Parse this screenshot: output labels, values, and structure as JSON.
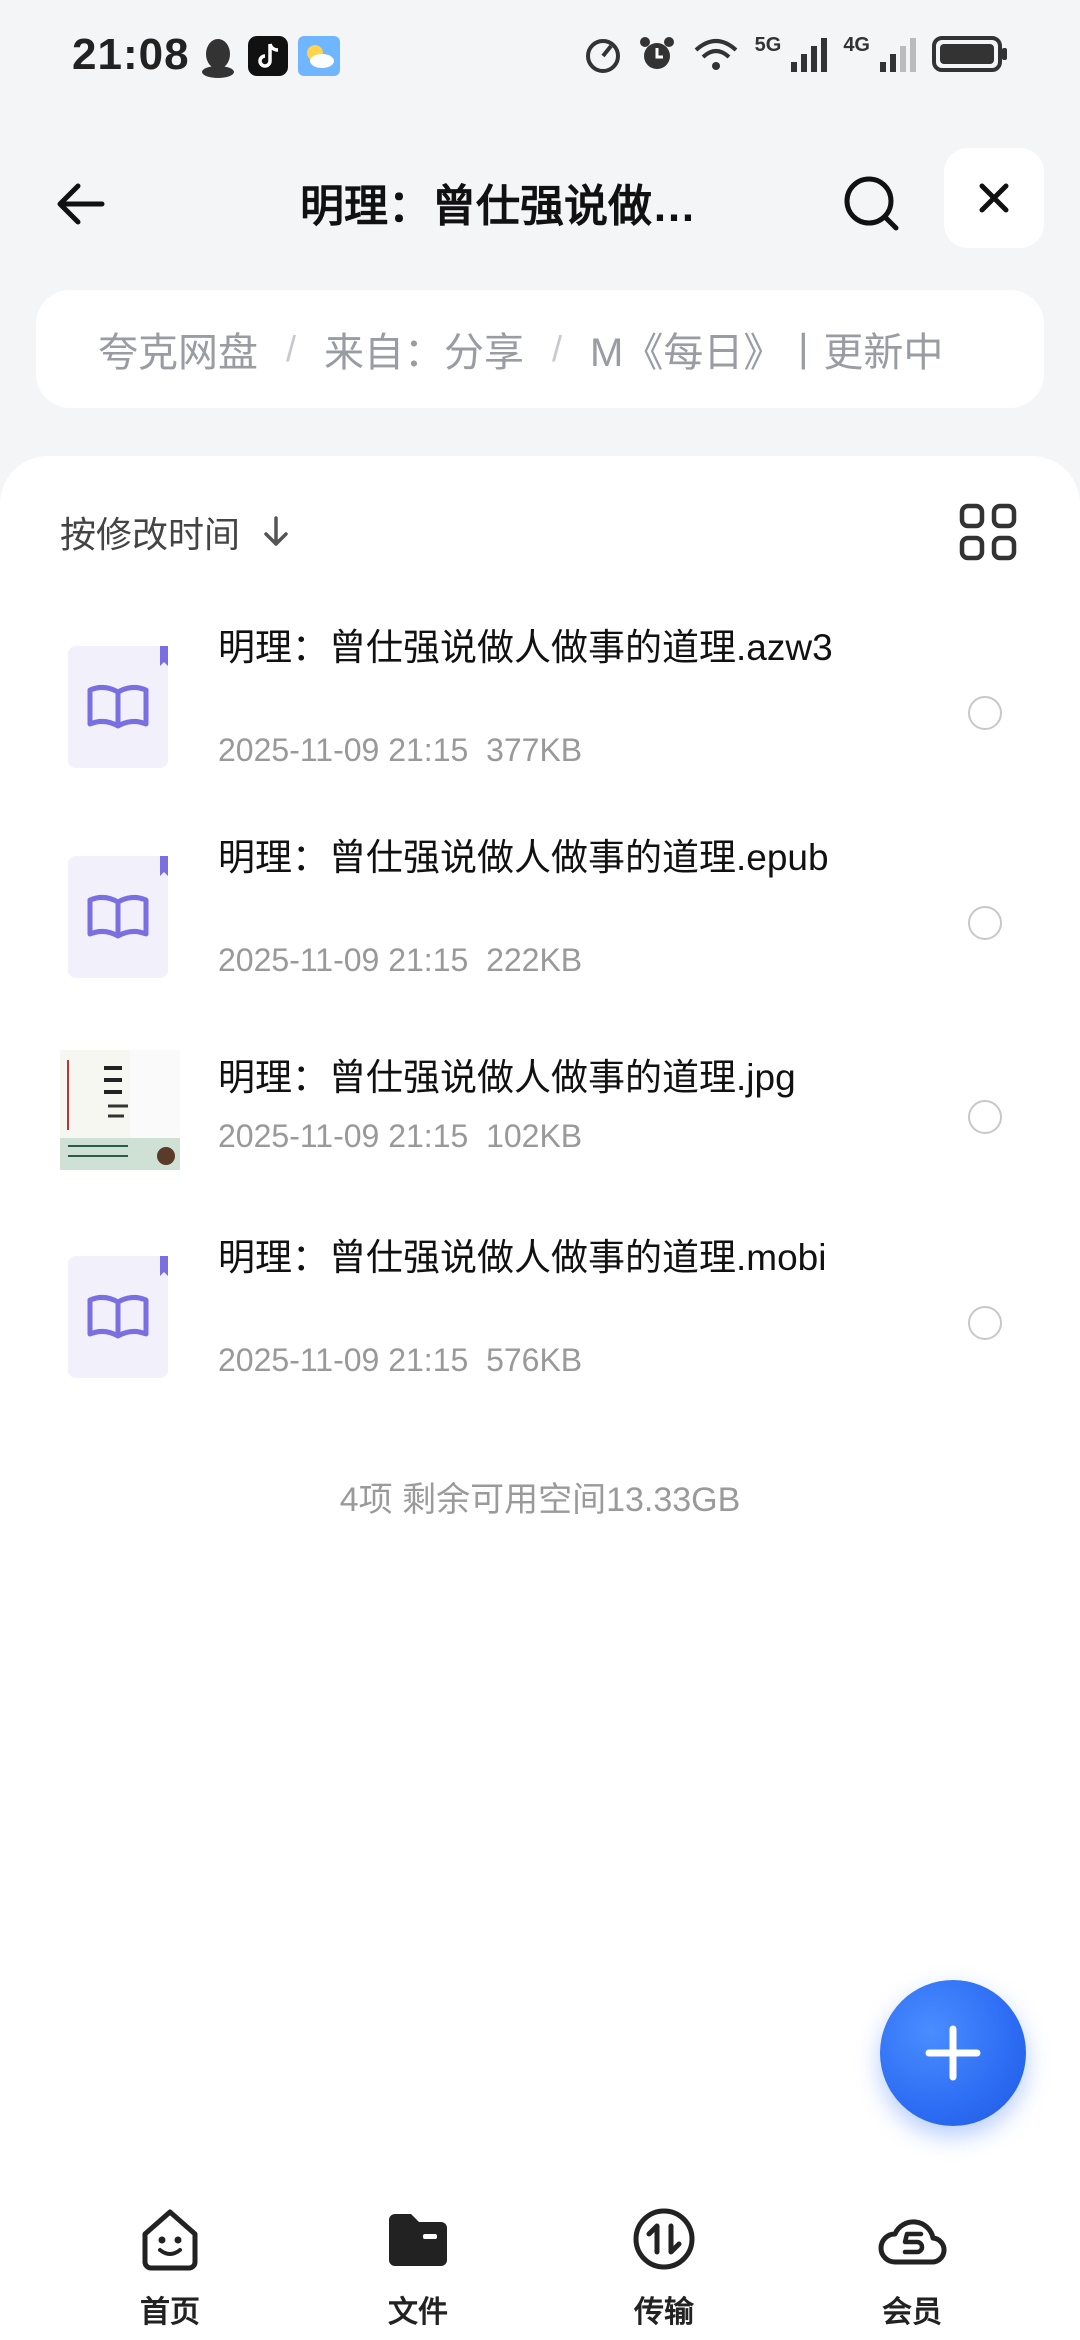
{
  "status_bar": {
    "time": "21:08",
    "network_5g": "5G",
    "network_4g": "4G"
  },
  "header": {
    "title": "明理：曾仕强说做…"
  },
  "breadcrumb": {
    "items": [
      "夸克网盘",
      "来自：分享",
      "M《每日》丨更新中"
    ],
    "separator": "/"
  },
  "toolbar": {
    "sort_label": "按修改时间"
  },
  "files": [
    {
      "name": "明理：曾仕强说做人做事的道理.azw3",
      "meta": "2025-11-09 21:15  377KB",
      "icon": "ebook-icon"
    },
    {
      "name": "明理：曾仕强说做人做事的道理.epub",
      "meta": "2025-11-09 21:15  222KB",
      "icon": "ebook-icon"
    },
    {
      "name": "明理：曾仕强说做人做事的道理.jpg",
      "meta": "2025-11-09 21:15  102KB",
      "icon": "image-thumbnail"
    },
    {
      "name": "明理：曾仕强说做人做事的道理.mobi",
      "meta": "2025-11-09 21:15  576KB",
      "icon": "ebook-icon"
    }
  ],
  "summary": "4项 剩余可用空间13.33GB",
  "bottom_nav": {
    "items": [
      {
        "label": "首页",
        "icon": "smiley-home-icon"
      },
      {
        "label": "文件",
        "icon": "folder-icon"
      },
      {
        "label": "传输",
        "icon": "transfer-icon"
      },
      {
        "label": "会员",
        "icon": "member-cloud-icon"
      }
    ]
  },
  "colors": {
    "accent": "#2f6ff5",
    "ebook_icon": "#7a6fe0",
    "background": "#f4f5f7"
  }
}
